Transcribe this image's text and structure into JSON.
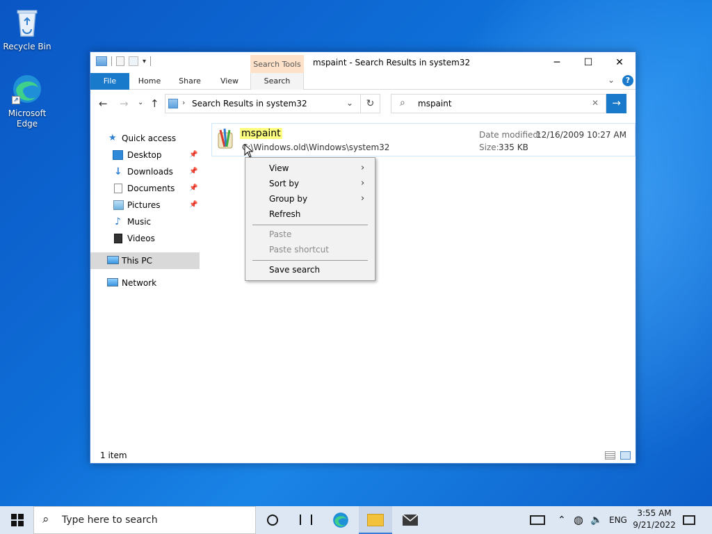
{
  "desktop": {
    "icons": [
      {
        "label": "Recycle Bin"
      },
      {
        "label": "Microsoft Edge"
      }
    ]
  },
  "window": {
    "title": "mspaint - Search Results in system32",
    "context_tab": "Search Tools",
    "tabs": {
      "file": "File",
      "home": "Home",
      "share": "Share",
      "view": "View",
      "search": "Search"
    },
    "address": "Search Results in system32",
    "search_query": "mspaint",
    "sidebar": {
      "quick_access": "Quick access",
      "desktop": "Desktop",
      "downloads": "Downloads",
      "documents": "Documents",
      "pictures": "Pictures",
      "music": "Music",
      "videos": "Videos",
      "this_pc": "This PC",
      "network": "Network"
    },
    "result": {
      "name": "mspaint",
      "path": "C:\\Windows.old\\Windows\\system32",
      "date_label": "Date modified:",
      "date_value": "12/16/2009 10:27 AM",
      "size_label": "Size:",
      "size_value": "335 KB"
    },
    "status": "1 item"
  },
  "context_menu": {
    "view": "View",
    "sort_by": "Sort by",
    "group_by": "Group by",
    "refresh": "Refresh",
    "paste": "Paste",
    "paste_shortcut": "Paste shortcut",
    "save_search": "Save search"
  },
  "taskbar": {
    "search_placeholder": "Type here to search",
    "language": "ENG",
    "time": "3:55 AM",
    "date": "9/21/2022"
  },
  "colors": {
    "accent": "#1979ca",
    "search_tools_tab": "#fde1c9",
    "highlight": "#ffff80"
  }
}
